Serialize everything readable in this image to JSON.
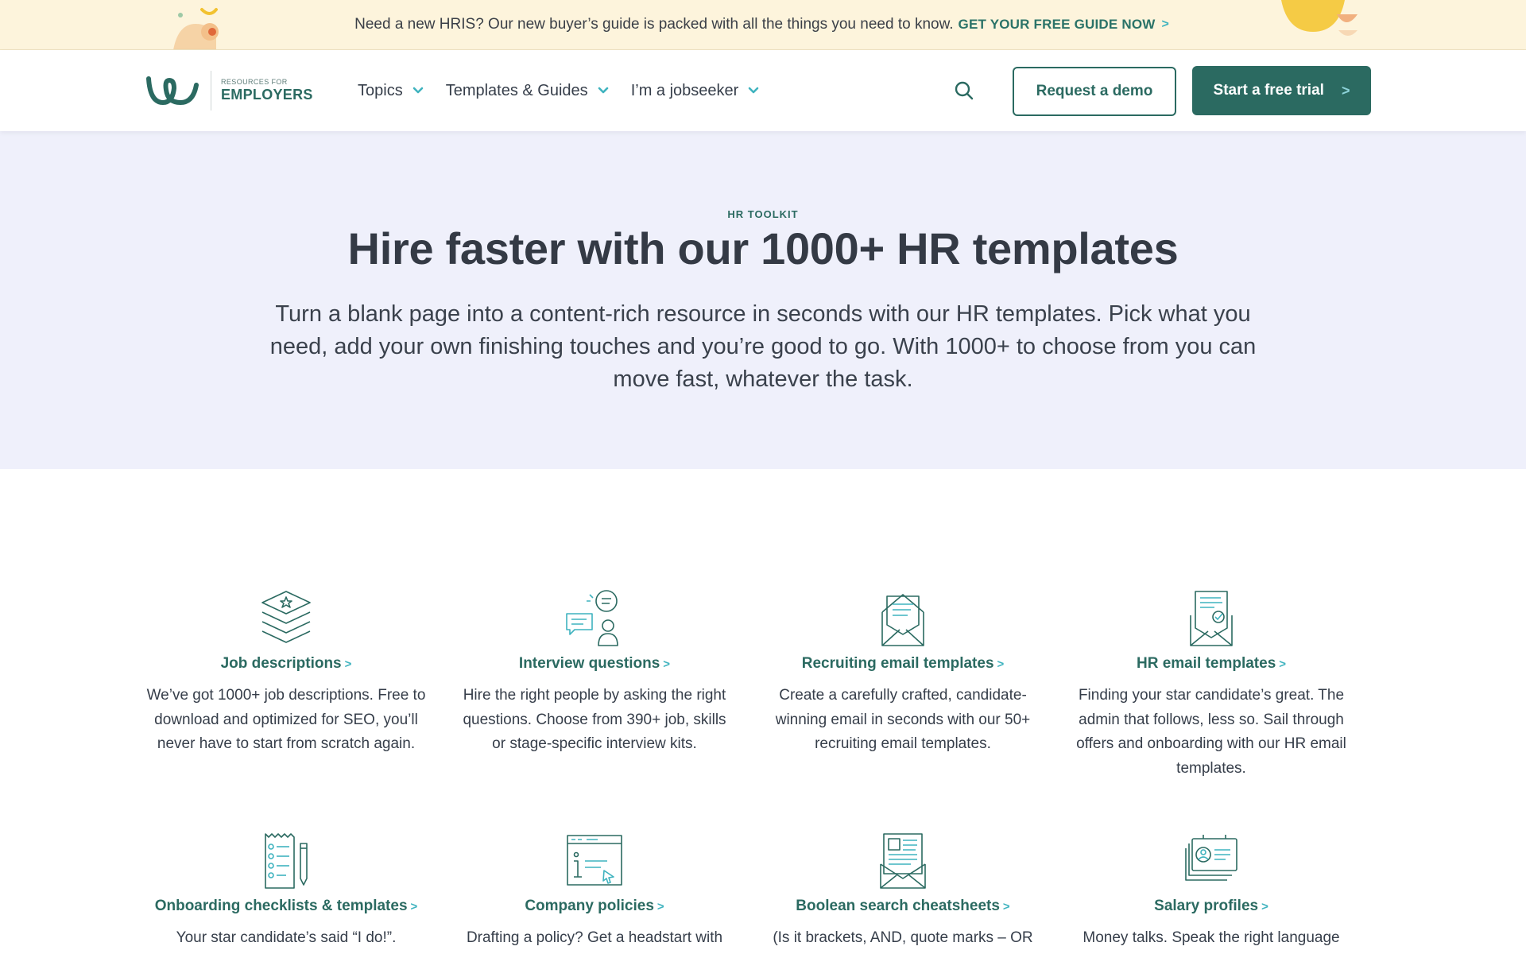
{
  "banner": {
    "message": "Need a new HRIS? Our new buyer’s guide is packed with all the things you need to know.",
    "cta": "GET YOUR FREE GUIDE NOW",
    "cta_chevron": ">"
  },
  "logo": {
    "small": "RESOURCES FOR",
    "big": "EMPLOYERS"
  },
  "nav": {
    "items": [
      {
        "label": "Topics"
      },
      {
        "label": "Templates & Guides"
      },
      {
        "label": "I’m a jobseeker"
      }
    ]
  },
  "header": {
    "demo_label": "Request a demo",
    "trial_label": "Start a free trial",
    "trial_chevron": ">"
  },
  "hero": {
    "eyebrow": "HR TOOLKIT",
    "title": "Hire faster with our 1000+ HR templates",
    "subtitle": "Turn a blank page into a content-rich resource in seconds with our HR templates. Pick what you need, add your own finishing touches and you’re good to go. With 1000+ to choose from you can move fast, whatever the task."
  },
  "cards": [
    {
      "title": "Job descriptions",
      "icon": "stacked-layers-star-icon",
      "desc": "We’ve got 1000+ job descriptions. Free to download and optimized for SEO, you’ll never have to start from scratch again."
    },
    {
      "title": "Interview questions",
      "icon": "interview-chat-icon",
      "desc": "Hire the right people by asking the right questions. Choose from 390+ job, skills or stage-specific interview kits."
    },
    {
      "title": "Recruiting email templates",
      "icon": "envelope-letter-icon",
      "desc": "Create a carefully crafted, candidate-winning email in seconds with our 50+ recruiting email templates."
    },
    {
      "title": "HR email templates",
      "icon": "envelope-check-icon",
      "desc": "Finding your star candidate’s great. The admin that follows, less so. Sail through offers and onboarding with our HR email templates."
    },
    {
      "title": "Onboarding checklists & templates",
      "icon": "checklist-pencil-icon",
      "desc": "Your star candidate’s said “I do!”."
    },
    {
      "title": "Company policies",
      "icon": "policy-window-icon",
      "desc": "Drafting a policy? Get a headstart with"
    },
    {
      "title": "Boolean search cheatsheets",
      "icon": "document-envelope-icon",
      "desc": "(Is it brackets, AND, quote marks – OR"
    },
    {
      "title": "Salary profiles",
      "icon": "profile-cards-icon",
      "desc": "Money talks. Speak the right language"
    }
  ],
  "colors": {
    "brand": "#2b6a61",
    "accent": "#3fb3bf",
    "banner_bg": "#fdf4dc",
    "hero_bg": "#eff0fb"
  }
}
